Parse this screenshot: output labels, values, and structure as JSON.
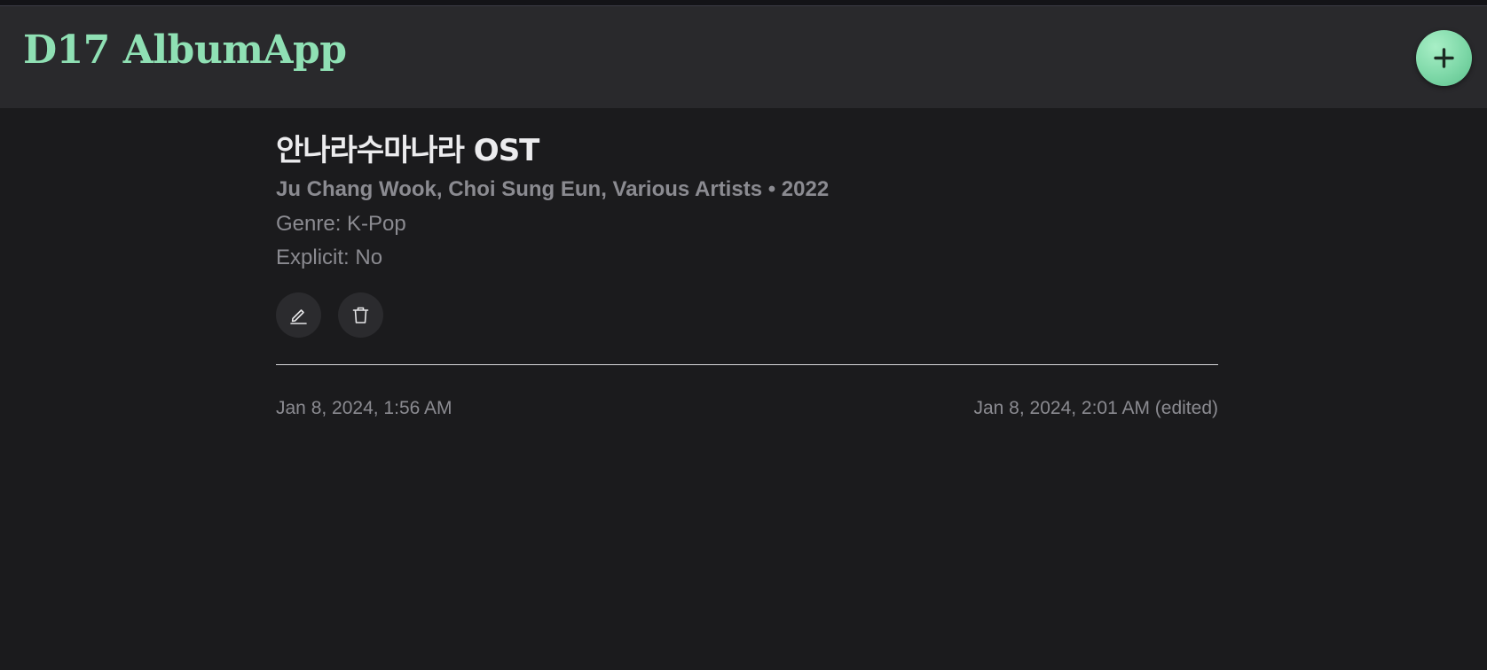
{
  "header": {
    "brand": "D17 AlbumApp",
    "add_icon": "plus-icon",
    "accent_color": "#8fe0b4"
  },
  "album": {
    "title": "안나라수마나라 OST",
    "subtitle": "Ju Chang Wook, Choi Sung Eun, Various Artists • 2022",
    "genre": "Genre: K-Pop",
    "explicit": "Explicit: No"
  },
  "actions": {
    "edit_icon": "pencil-icon",
    "delete_icon": "trash-icon"
  },
  "timestamps": {
    "created": "Jan 8, 2024, 1:56 AM",
    "edited": "Jan 8, 2024, 2:01 AM (edited)"
  }
}
